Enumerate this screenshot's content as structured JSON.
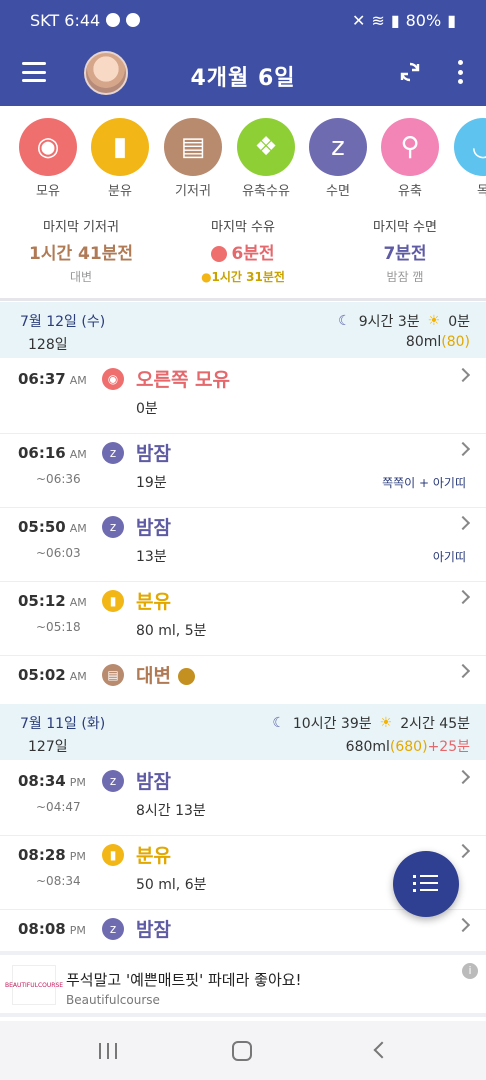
{
  "status": {
    "carrier_time": "SKT 6:44",
    "battery": "80%"
  },
  "appbar": {
    "title": "4개월 6일"
  },
  "categories": [
    {
      "label": "모유",
      "color": "#ef6f6f",
      "glyph": "◉"
    },
    {
      "label": "분유",
      "color": "#f2b616",
      "glyph": "▮"
    },
    {
      "label": "기저귀",
      "color": "#b88a6e",
      "glyph": "▤"
    },
    {
      "label": "유축수유",
      "color": "#8fcf36",
      "glyph": "❖"
    },
    {
      "label": "수면",
      "color": "#6f6bb1",
      "glyph": "z"
    },
    {
      "label": "유축",
      "color": "#f384b6",
      "glyph": "⚲"
    },
    {
      "label": "목",
      "color": "#5ec3ee",
      "glyph": "◡"
    }
  ],
  "summary": {
    "diaper": {
      "title": "마지막 기저귀",
      "value": "1시간 41분전",
      "sub": "대변"
    },
    "feed": {
      "title": "마지막 수유",
      "value": "6분전",
      "sub": "1시간 31분전"
    },
    "sleep": {
      "title": "마지막 수면",
      "value": "7분전",
      "sub": "밤잠 깸"
    }
  },
  "days": [
    {
      "date": "7월 12일 (수)",
      "age": "128일",
      "night_sleep": "9시간 3분",
      "day_sleep": "0분",
      "ml": "80ml",
      "ml_paren": "(80)",
      "ml_extra": ""
    },
    {
      "date": "7월 11일 (화)",
      "age": "127일",
      "night_sleep": "10시간 39분",
      "day_sleep": "2시간 45분",
      "ml": "680ml",
      "ml_paren": "(680)",
      "ml_extra": "+25분"
    }
  ],
  "entries": [
    {
      "time": "06:37",
      "ampm": "AM",
      "end": "",
      "title": "오른쪽 모유",
      "detail": "0분",
      "tag": ""
    },
    {
      "time": "06:16",
      "ampm": "AM",
      "end": "~06:36",
      "title": "밤잠",
      "detail": "19분",
      "tag": "쪽쪽이 + 아기띠"
    },
    {
      "time": "05:50",
      "ampm": "AM",
      "end": "~06:03",
      "title": "밤잠",
      "detail": "13분",
      "tag": "아기띠"
    },
    {
      "time": "05:12",
      "ampm": "AM",
      "end": "~05:18",
      "title": "분유",
      "detail": "80 ml, 5분",
      "tag": ""
    },
    {
      "time": "05:02",
      "ampm": "AM",
      "end": "",
      "title": "대변",
      "detail": "",
      "tag": ""
    },
    {
      "time": "08:34",
      "ampm": "PM",
      "end": "~04:47",
      "title": "밤잠",
      "detail": "8시간 13분",
      "tag": ""
    },
    {
      "time": "08:28",
      "ampm": "PM",
      "end": "~08:34",
      "title": "분유",
      "detail": "50 ml, 6분",
      "tag": ""
    },
    {
      "time": "08:08",
      "ampm": "PM",
      "end": "",
      "title": "밤잠",
      "detail": "",
      "tag": ""
    }
  ],
  "ad": {
    "title": "푸석말고 '예쁜매트핏' 파데라 좋아요!",
    "sub": "Beautifulcourse",
    "logo": "BEAUTIFULCOURSE"
  },
  "colors": {
    "primary": "#3f4fa3",
    "breast": "#e4686c",
    "formula": "#e2a800",
    "sleep": "#5e5aa3",
    "diaper": "#b07a55"
  }
}
